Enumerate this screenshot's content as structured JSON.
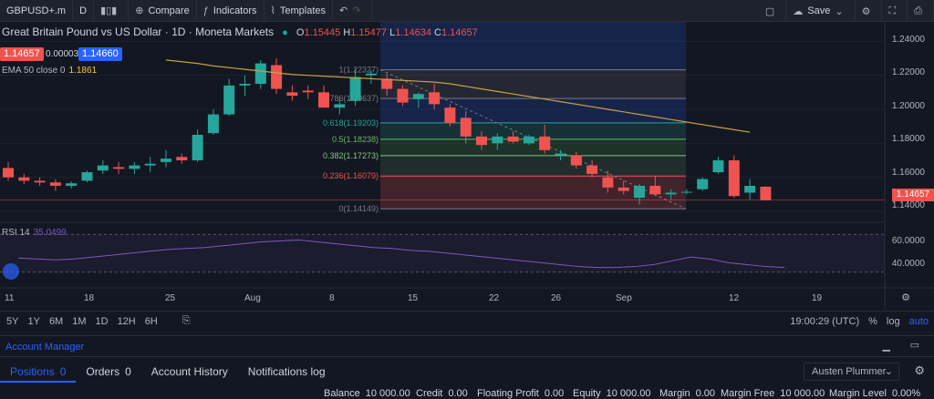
{
  "toolbar": {
    "symbol": "GBPUSD+.m",
    "interval": "D",
    "compare": "Compare",
    "indicators": "Indicators",
    "templates": "Templates",
    "save": "Save"
  },
  "legend": {
    "title": "Great Britain Pound vs US Dollar · 1D · Moneta Markets",
    "o_label": "O",
    "o": "1.15445",
    "h_label": "H",
    "h": "1.15477",
    "l_label": "L",
    "l": "1.14634",
    "c_label": "C",
    "c": "1.14657",
    "bid": "1.14657",
    "spread": "0.00003",
    "ask": "1.14660"
  },
  "ema": {
    "label": "EMA 50 close 0",
    "value": "1.1861"
  },
  "rsi": {
    "label": "RSI 14",
    "value": "35.0499"
  },
  "price_axis": [
    "1.24000",
    "1.22000",
    "1.20000",
    "1.18000",
    "1.16000",
    "1.14000"
  ],
  "last_price": "1.14657",
  "fib": [
    {
      "label": "1(1.22327)",
      "color": "#787b86"
    },
    {
      "label": "0.786(1.20637)",
      "color": "#787b86"
    },
    {
      "label": "0.618(1.19203)",
      "color": "#26a69a"
    },
    {
      "label": "0.5(1.18238)",
      "color": "#66bb6a"
    },
    {
      "label": "0.382(1.17273)",
      "color": "#81c784"
    },
    {
      "label": "0.236(1.16079)",
      "color": "#ef5350"
    },
    {
      "label": "0(1.14149)",
      "color": "#787b86"
    }
  ],
  "rsi_axis": [
    "60.0000",
    "40.0000"
  ],
  "time_axis": [
    "11",
    "18",
    "25",
    "Aug",
    "8",
    "15",
    "22",
    "26",
    "Sep",
    "12",
    "19"
  ],
  "timeframes": [
    "5Y",
    "1Y",
    "6M",
    "1M",
    "1D",
    "12H",
    "6H"
  ],
  "clock": "19:00:29 (UTC)",
  "scale": {
    "percent": "%",
    "log": "log",
    "auto": "auto"
  },
  "account": {
    "title": "Account Manager",
    "tabs": [
      {
        "label": "Positions",
        "count": "0"
      },
      {
        "label": "Orders",
        "count": "0"
      },
      {
        "label": "Account History",
        "count": ""
      },
      {
        "label": "Notifications log",
        "count": ""
      }
    ],
    "user": "Austen Plummer",
    "stats": [
      {
        "label": "Balance",
        "value": "10 000.00"
      },
      {
        "label": "Credit",
        "value": "0.00"
      },
      {
        "label": "Floating Profit",
        "value": "0.00"
      },
      {
        "label": "Equity",
        "value": "10 000.00"
      },
      {
        "label": "Margin",
        "value": "0.00"
      },
      {
        "label": "Margin Free",
        "value": "10 000.00"
      },
      {
        "label": "Margin Level",
        "value": "0.00%"
      }
    ]
  },
  "chart_data": {
    "type": "candlestick",
    "ylim": [
      1.14,
      1.245
    ],
    "candles": [
      {
        "o": 1.1655,
        "h": 1.169,
        "l": 1.158,
        "c": 1.16
      },
      {
        "o": 1.16,
        "h": 1.162,
        "l": 1.156,
        "c": 1.158
      },
      {
        "o": 1.158,
        "h": 1.16,
        "l": 1.155,
        "c": 1.157
      },
      {
        "o": 1.157,
        "h": 1.159,
        "l": 1.152,
        "c": 1.155
      },
      {
        "o": 1.155,
        "h": 1.1575,
        "l": 1.1535,
        "c": 1.1565
      },
      {
        "o": 1.158,
        "h": 1.164,
        "l": 1.157,
        "c": 1.163
      },
      {
        "o": 1.164,
        "h": 1.17,
        "l": 1.162,
        "c": 1.167
      },
      {
        "o": 1.166,
        "h": 1.169,
        "l": 1.162,
        "c": 1.165
      },
      {
        "o": 1.165,
        "h": 1.169,
        "l": 1.162,
        "c": 1.167
      },
      {
        "o": 1.167,
        "h": 1.172,
        "l": 1.163,
        "c": 1.168
      },
      {
        "o": 1.169,
        "h": 1.176,
        "l": 1.166,
        "c": 1.171
      },
      {
        "o": 1.172,
        "h": 1.174,
        "l": 1.168,
        "c": 1.17
      },
      {
        "o": 1.17,
        "h": 1.188,
        "l": 1.169,
        "c": 1.185
      },
      {
        "o": 1.186,
        "h": 1.2,
        "l": 1.185,
        "c": 1.197
      },
      {
        "o": 1.197,
        "h": 1.218,
        "l": 1.196,
        "c": 1.214
      },
      {
        "o": 1.214,
        "h": 1.22,
        "l": 1.208,
        "c": 1.215
      },
      {
        "o": 1.215,
        "h": 1.229,
        "l": 1.212,
        "c": 1.227
      },
      {
        "o": 1.226,
        "h": 1.23,
        "l": 1.209,
        "c": 1.212
      },
      {
        "o": 1.21,
        "h": 1.214,
        "l": 1.205,
        "c": 1.208
      },
      {
        "o": 1.211,
        "h": 1.214,
        "l": 1.206,
        "c": 1.21
      },
      {
        "o": 1.21,
        "h": 1.214,
        "l": 1.206,
        "c": 1.201
      },
      {
        "o": 1.201,
        "h": 1.206,
        "l": 1.197,
        "c": 1.203
      },
      {
        "o": 1.205,
        "h": 1.224,
        "l": 1.202,
        "c": 1.219
      },
      {
        "o": 1.22,
        "h": 1.223,
        "l": 1.215,
        "c": 1.221
      },
      {
        "o": 1.218,
        "h": 1.221,
        "l": 1.208,
        "c": 1.212
      },
      {
        "o": 1.212,
        "h": 1.214,
        "l": 1.202,
        "c": 1.204
      },
      {
        "o": 1.206,
        "h": 1.21,
        "l": 1.201,
        "c": 1.209
      },
      {
        "o": 1.21,
        "h": 1.215,
        "l": 1.2,
        "c": 1.203
      },
      {
        "o": 1.201,
        "h": 1.203,
        "l": 1.19,
        "c": 1.192
      },
      {
        "o": 1.195,
        "h": 1.199,
        "l": 1.18,
        "c": 1.184
      },
      {
        "o": 1.184,
        "h": 1.187,
        "l": 1.176,
        "c": 1.179
      },
      {
        "o": 1.18,
        "h": 1.186,
        "l": 1.176,
        "c": 1.184
      },
      {
        "o": 1.184,
        "h": 1.187,
        "l": 1.18,
        "c": 1.181
      },
      {
        "o": 1.18,
        "h": 1.185,
        "l": 1.179,
        "c": 1.184
      },
      {
        "o": 1.184,
        "h": 1.191,
        "l": 1.174,
        "c": 1.176
      },
      {
        "o": 1.173,
        "h": 1.176,
        "l": 1.17,
        "c": 1.174
      },
      {
        "o": 1.173,
        "h": 1.175,
        "l": 1.165,
        "c": 1.167
      },
      {
        "o": 1.167,
        "h": 1.17,
        "l": 1.16,
        "c": 1.162
      },
      {
        "o": 1.16,
        "h": 1.164,
        "l": 1.151,
        "c": 1.154
      },
      {
        "o": 1.154,
        "h": 1.158,
        "l": 1.15,
        "c": 1.152
      },
      {
        "o": 1.148,
        "h": 1.156,
        "l": 1.144,
        "c": 1.155
      },
      {
        "o": 1.155,
        "h": 1.161,
        "l": 1.149,
        "c": 1.15
      },
      {
        "o": 1.15,
        "h": 1.153,
        "l": 1.147,
        "c": 1.151
      },
      {
        "o": 1.151,
        "h": 1.153,
        "l": 1.15,
        "c": 1.1515
      },
      {
        "o": 1.153,
        "h": 1.16,
        "l": 1.152,
        "c": 1.159
      },
      {
        "o": 1.163,
        "h": 1.172,
        "l": 1.162,
        "c": 1.17
      },
      {
        "o": 1.17,
        "h": 1.173,
        "l": 1.148,
        "c": 1.149
      },
      {
        "o": 1.151,
        "h": 1.159,
        "l": 1.147,
        "c": 1.155
      },
      {
        "o": 1.1545,
        "h": 1.1548,
        "l": 1.1463,
        "c": 1.1466
      }
    ],
    "ema": [
      1.229,
      1.228,
      1.227,
      1.2255,
      1.2245,
      1.2235,
      1.2225,
      1.2215,
      1.2205,
      1.22,
      1.2195,
      1.219,
      1.2185,
      1.218,
      1.2175,
      1.217,
      1.2165,
      1.216,
      1.215,
      1.2135,
      1.212,
      1.2105,
      1.209,
      1.2075,
      1.206,
      1.2045,
      1.203,
      1.2015,
      1.2,
      1.1985,
      1.197,
      1.1955,
      1.194,
      1.1925,
      1.191,
      1.1895,
      1.188,
      1.1865
    ],
    "rsi": [
      45,
      44,
      43,
      44,
      46,
      48,
      50,
      52,
      54,
      55,
      56,
      58,
      60,
      62,
      63,
      64,
      62,
      60,
      58,
      56,
      55,
      53,
      52,
      50,
      48,
      46,
      44,
      42,
      40,
      38,
      36,
      35,
      35,
      36,
      38,
      42,
      46,
      44,
      40,
      38,
      36,
      35
    ]
  }
}
